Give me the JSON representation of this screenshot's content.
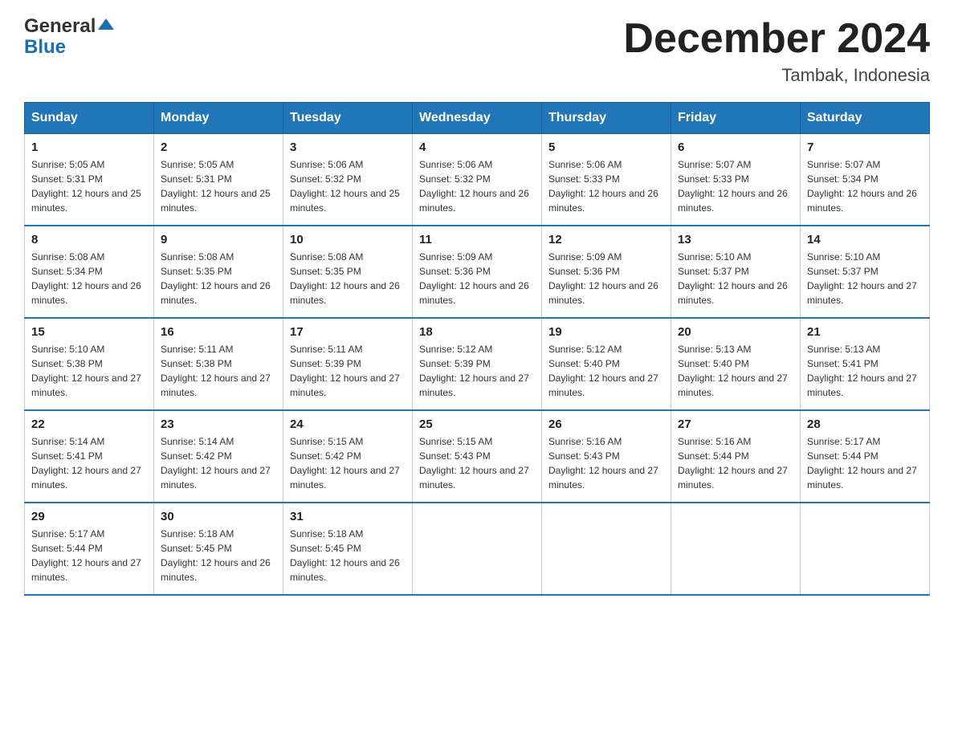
{
  "header": {
    "logo_general": "General",
    "logo_blue": "Blue",
    "month_title": "December 2024",
    "location": "Tambak, Indonesia"
  },
  "days_of_week": [
    "Sunday",
    "Monday",
    "Tuesday",
    "Wednesday",
    "Thursday",
    "Friday",
    "Saturday"
  ],
  "weeks": [
    [
      {
        "num": "1",
        "sunrise": "5:05 AM",
        "sunset": "5:31 PM",
        "daylight": "12 hours and 25 minutes."
      },
      {
        "num": "2",
        "sunrise": "5:05 AM",
        "sunset": "5:31 PM",
        "daylight": "12 hours and 25 minutes."
      },
      {
        "num": "3",
        "sunrise": "5:06 AM",
        "sunset": "5:32 PM",
        "daylight": "12 hours and 25 minutes."
      },
      {
        "num": "4",
        "sunrise": "5:06 AM",
        "sunset": "5:32 PM",
        "daylight": "12 hours and 26 minutes."
      },
      {
        "num": "5",
        "sunrise": "5:06 AM",
        "sunset": "5:33 PM",
        "daylight": "12 hours and 26 minutes."
      },
      {
        "num": "6",
        "sunrise": "5:07 AM",
        "sunset": "5:33 PM",
        "daylight": "12 hours and 26 minutes."
      },
      {
        "num": "7",
        "sunrise": "5:07 AM",
        "sunset": "5:34 PM",
        "daylight": "12 hours and 26 minutes."
      }
    ],
    [
      {
        "num": "8",
        "sunrise": "5:08 AM",
        "sunset": "5:34 PM",
        "daylight": "12 hours and 26 minutes."
      },
      {
        "num": "9",
        "sunrise": "5:08 AM",
        "sunset": "5:35 PM",
        "daylight": "12 hours and 26 minutes."
      },
      {
        "num": "10",
        "sunrise": "5:08 AM",
        "sunset": "5:35 PM",
        "daylight": "12 hours and 26 minutes."
      },
      {
        "num": "11",
        "sunrise": "5:09 AM",
        "sunset": "5:36 PM",
        "daylight": "12 hours and 26 minutes."
      },
      {
        "num": "12",
        "sunrise": "5:09 AM",
        "sunset": "5:36 PM",
        "daylight": "12 hours and 26 minutes."
      },
      {
        "num": "13",
        "sunrise": "5:10 AM",
        "sunset": "5:37 PM",
        "daylight": "12 hours and 26 minutes."
      },
      {
        "num": "14",
        "sunrise": "5:10 AM",
        "sunset": "5:37 PM",
        "daylight": "12 hours and 27 minutes."
      }
    ],
    [
      {
        "num": "15",
        "sunrise": "5:10 AM",
        "sunset": "5:38 PM",
        "daylight": "12 hours and 27 minutes."
      },
      {
        "num": "16",
        "sunrise": "5:11 AM",
        "sunset": "5:38 PM",
        "daylight": "12 hours and 27 minutes."
      },
      {
        "num": "17",
        "sunrise": "5:11 AM",
        "sunset": "5:39 PM",
        "daylight": "12 hours and 27 minutes."
      },
      {
        "num": "18",
        "sunrise": "5:12 AM",
        "sunset": "5:39 PM",
        "daylight": "12 hours and 27 minutes."
      },
      {
        "num": "19",
        "sunrise": "5:12 AM",
        "sunset": "5:40 PM",
        "daylight": "12 hours and 27 minutes."
      },
      {
        "num": "20",
        "sunrise": "5:13 AM",
        "sunset": "5:40 PM",
        "daylight": "12 hours and 27 minutes."
      },
      {
        "num": "21",
        "sunrise": "5:13 AM",
        "sunset": "5:41 PM",
        "daylight": "12 hours and 27 minutes."
      }
    ],
    [
      {
        "num": "22",
        "sunrise": "5:14 AM",
        "sunset": "5:41 PM",
        "daylight": "12 hours and 27 minutes."
      },
      {
        "num": "23",
        "sunrise": "5:14 AM",
        "sunset": "5:42 PM",
        "daylight": "12 hours and 27 minutes."
      },
      {
        "num": "24",
        "sunrise": "5:15 AM",
        "sunset": "5:42 PM",
        "daylight": "12 hours and 27 minutes."
      },
      {
        "num": "25",
        "sunrise": "5:15 AM",
        "sunset": "5:43 PM",
        "daylight": "12 hours and 27 minutes."
      },
      {
        "num": "26",
        "sunrise": "5:16 AM",
        "sunset": "5:43 PM",
        "daylight": "12 hours and 27 minutes."
      },
      {
        "num": "27",
        "sunrise": "5:16 AM",
        "sunset": "5:44 PM",
        "daylight": "12 hours and 27 minutes."
      },
      {
        "num": "28",
        "sunrise": "5:17 AM",
        "sunset": "5:44 PM",
        "daylight": "12 hours and 27 minutes."
      }
    ],
    [
      {
        "num": "29",
        "sunrise": "5:17 AM",
        "sunset": "5:44 PM",
        "daylight": "12 hours and 27 minutes."
      },
      {
        "num": "30",
        "sunrise": "5:18 AM",
        "sunset": "5:45 PM",
        "daylight": "12 hours and 26 minutes."
      },
      {
        "num": "31",
        "sunrise": "5:18 AM",
        "sunset": "5:45 PM",
        "daylight": "12 hours and 26 minutes."
      },
      null,
      null,
      null,
      null
    ]
  ]
}
